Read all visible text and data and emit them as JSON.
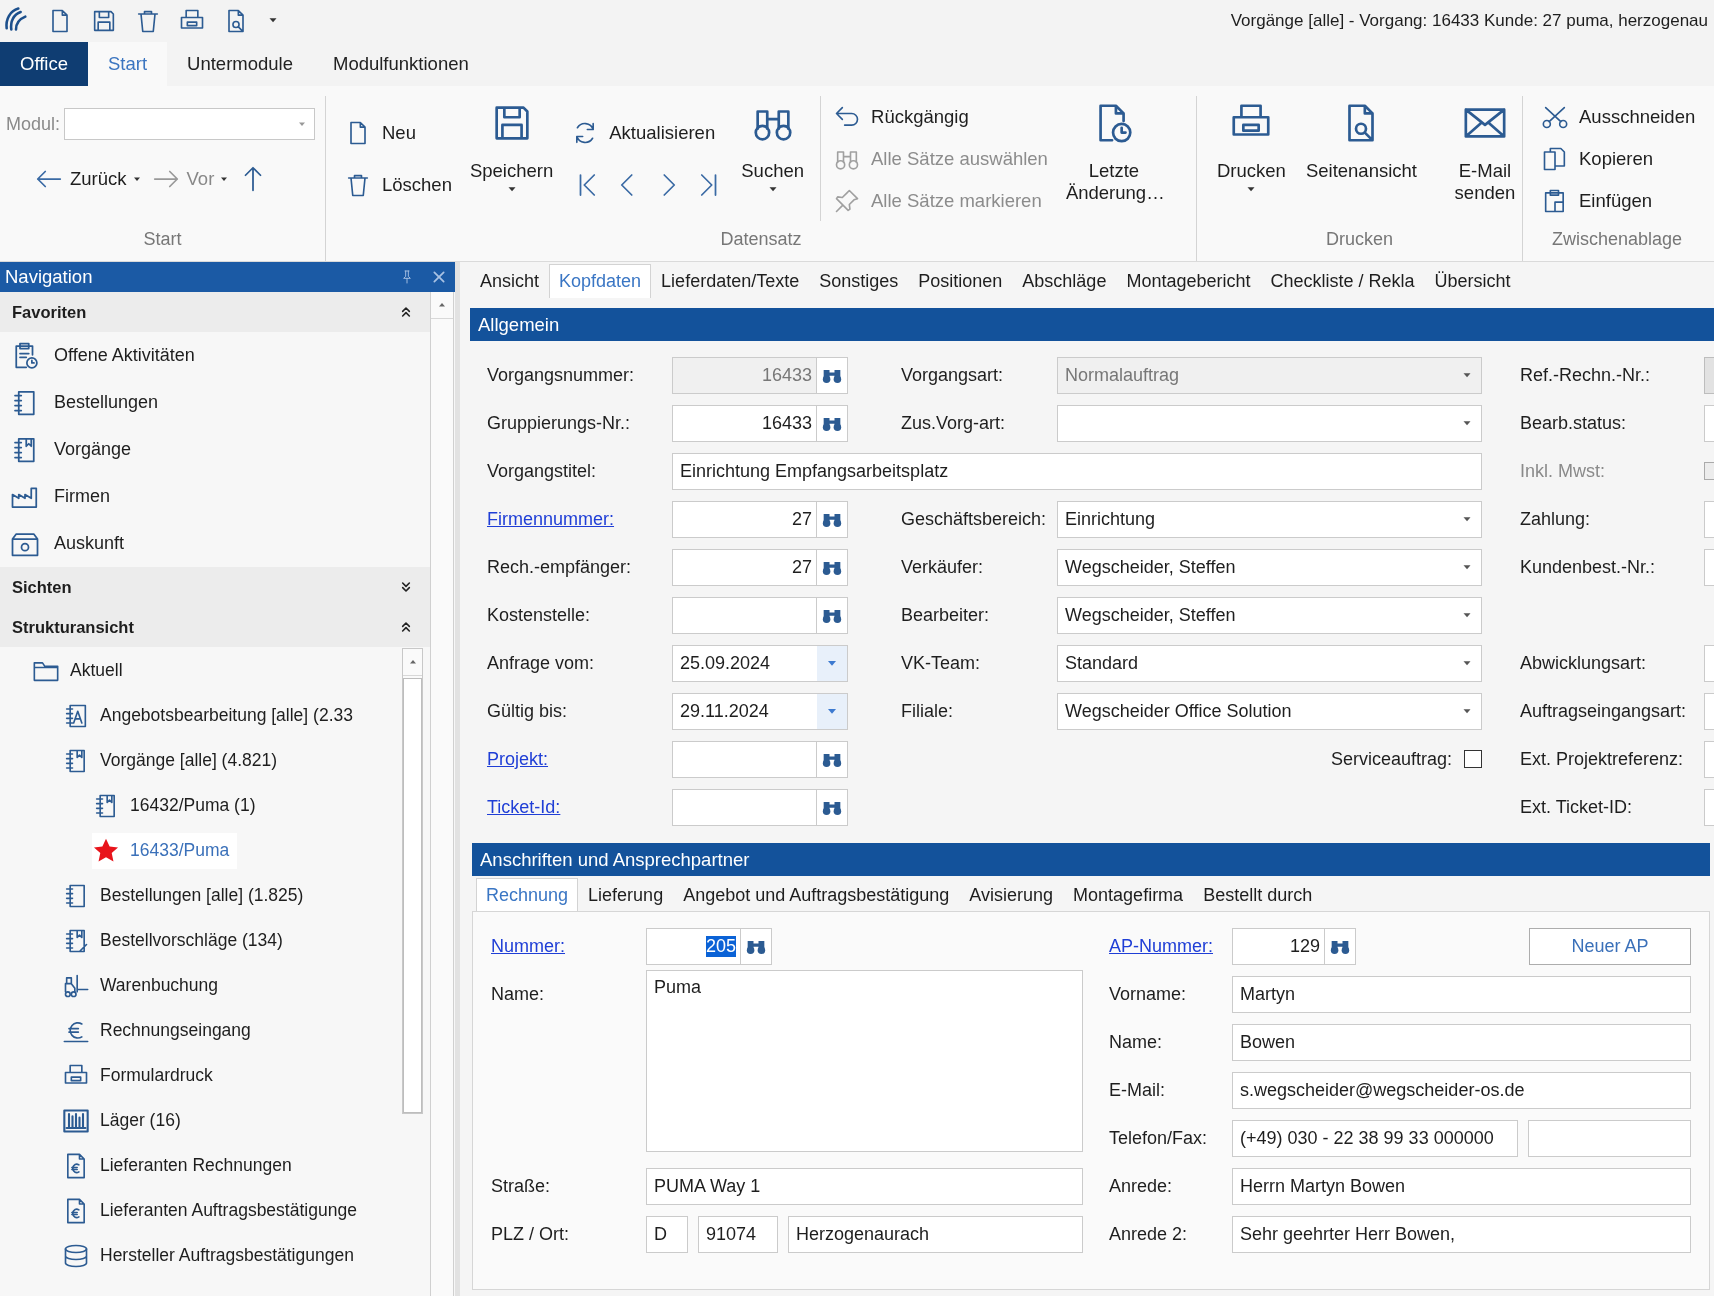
{
  "title_bar": {
    "title": "Vorgänge [alle] - Vorgang: 16433 Kunde: 27 puma, herzogenau"
  },
  "ribbon_tabs": [
    {
      "label": "Office",
      "kind": "app",
      "selected": false
    },
    {
      "label": "Start",
      "kind": "tab",
      "selected": true
    },
    {
      "label": "Untermodule",
      "kind": "tab",
      "selected": false
    },
    {
      "label": "Modulfunktionen",
      "kind": "tab",
      "selected": false
    }
  ],
  "ribbon": {
    "start": {
      "module_label": "Modul:",
      "back": {
        "label": "Zurück",
        "disabled": false
      },
      "forward": {
        "label": "Vor",
        "disabled": true
      },
      "label": "Start"
    },
    "record": {
      "new": "Neu",
      "delete": "Löschen",
      "save": {
        "label": "Speichern",
        "dropdown": true
      },
      "refresh": "Aktualisieren",
      "search": {
        "label": "Suchen",
        "dropdown": true
      },
      "undo": {
        "label": "Rückgängig",
        "disabled": false
      },
      "select_all": {
        "label": "Alle Sätze auswählen",
        "disabled": true
      },
      "mark_all": {
        "label": "Alle Sätze markieren",
        "disabled": true
      },
      "last_change": {
        "label": "Letzte Änderung…",
        "dropdown": false
      },
      "label": "Datensatz"
    },
    "print": {
      "print": {
        "label": "Drucken",
        "dropdown": true
      },
      "preview": {
        "label": "Seitenansicht",
        "dropdown": false
      },
      "email": {
        "label": "E-Mail senden",
        "dropdown": false
      },
      "label": "Drucken"
    },
    "clipboard": {
      "cut": "Ausschneiden",
      "copy": "Kopieren",
      "paste": "Einfügen",
      "label": "Zwischenablage"
    }
  },
  "navigation": {
    "title": "Navigation",
    "sections": [
      {
        "title": "Favoriten",
        "expanded": true,
        "items": [
          "Offene Aktivitäten",
          "Bestellungen",
          "Vorgänge",
          "Firmen",
          "Auskunft"
        ]
      },
      {
        "title": "Sichten",
        "expanded": false
      },
      {
        "title": "Strukturansicht",
        "expanded": true,
        "tree": [
          {
            "label": "Aktuell",
            "selected": false,
            "children": [
              {
                "label": "Angebotsbearbeitung [alle] (2.33",
                "selected": false
              },
              {
                "label": "Vorgänge [alle] (4.821)",
                "selected": false,
                "children": [
                  {
                    "label": "16432/Puma (1)",
                    "selected": false
                  },
                  {
                    "label": "16433/Puma",
                    "selected": true
                  }
                ]
              },
              {
                "label": "Bestellungen [alle] (1.825)",
                "selected": false
              },
              {
                "label": "Bestellvorschläge (134)",
                "selected": false
              },
              {
                "label": "Warenbuchung",
                "selected": false
              },
              {
                "label": "Rechnungseingang",
                "selected": false
              },
              {
                "label": "Formulardruck",
                "selected": false
              },
              {
                "label": "Läger (16)",
                "selected": false
              },
              {
                "label": "Lieferanten Rechnungen",
                "selected": false
              },
              {
                "label": "Lieferanten Auftragsbestätigunge",
                "selected": false
              },
              {
                "label": "Hersteller Auftragsbestätigungen",
                "selected": false
              }
            ]
          }
        ]
      }
    ]
  },
  "tabs": [
    {
      "label": "Ansicht",
      "selected": false
    },
    {
      "label": "Kopfdaten",
      "selected": true
    },
    {
      "label": "Lieferdaten/Texte",
      "selected": false
    },
    {
      "label": "Sonstiges",
      "selected": false
    },
    {
      "label": "Positionen",
      "selected": false
    },
    {
      "label": "Abschläge",
      "selected": false
    },
    {
      "label": "Montagebericht",
      "selected": false
    },
    {
      "label": "Checkliste / Rekla",
      "selected": false
    },
    {
      "label": "Übersicht",
      "selected": false
    }
  ],
  "general": {
    "title": "Allgemein",
    "rows": [
      {
        "left": {
          "label": "Vorgangsnummer:",
          "link": false,
          "kind": "lookup",
          "value": "16433",
          "disabled": true
        },
        "middle": {
          "label": "Vorgangsart:",
          "kind": "combo",
          "value": "Normalauftrag",
          "disabled": true
        },
        "right": {
          "label": "Ref.-Rechn.-Nr.:",
          "kind": "stub",
          "disabled": true
        }
      },
      {
        "left": {
          "label": "Gruppierungs-Nr.:",
          "link": false,
          "kind": "lookup",
          "value": "16433",
          "disabled": false
        },
        "middle": {
          "label": "Zus.Vorg-art:",
          "kind": "combo",
          "disabled": false
        },
        "right": {
          "label": "Bearb.status:",
          "kind": "stub",
          "disabled": false
        }
      },
      {
        "left": {
          "label": "Vorgangstitel:",
          "link": false,
          "kind": "wide",
          "value": "Einrichtung Empfangsarbeitsplatz"
        },
        "right": {
          "label": "Inkl. Mwst:",
          "kind": "check",
          "checked": false,
          "disabled": true
        }
      },
      {
        "left": {
          "label": "Firmennummer:",
          "link": true,
          "kind": "lookup",
          "value": "27",
          "disabled": false
        },
        "middle": {
          "label": "Geschäftsbereich:",
          "kind": "combo",
          "value": "Einrichtung",
          "disabled": false
        },
        "right": {
          "label": "Zahlung:",
          "kind": "stub",
          "disabled": false
        }
      },
      {
        "left": {
          "label": "Rech.-empfänger:",
          "link": false,
          "kind": "lookup",
          "value": "27",
          "disabled": false
        },
        "middle": {
          "label": "Verkäufer:",
          "kind": "combo",
          "value": "Wegscheider, Steffen",
          "disabled": false
        },
        "right": {
          "label": "Kundenbest.-Nr.:",
          "kind": "stub",
          "disabled": false
        }
      },
      {
        "left": {
          "label": "Kostenstelle:",
          "link": false,
          "kind": "lookup",
          "disabled": false
        },
        "middle": {
          "label": "Bearbeiter:",
          "kind": "combo",
          "value": "Wegscheider, Steffen",
          "disabled": false
        }
      },
      {
        "left": {
          "label": "Anfrage vom:",
          "link": false,
          "kind": "date",
          "value": "25.09.2024"
        },
        "middle": {
          "label": "VK-Team:",
          "kind": "combo",
          "value": "Standard",
          "disabled": false
        },
        "right": {
          "label": "Abwicklungsart:",
          "kind": "stub",
          "disabled": false
        }
      },
      {
        "left": {
          "label": "Gültig bis:",
          "link": false,
          "kind": "date",
          "value": "29.11.2024"
        },
        "middle": {
          "label": "Filiale:",
          "kind": "combo",
          "value": "Wegscheider Office Solution",
          "disabled": false
        },
        "right": {
          "label": "Auftragseingangsart:",
          "kind": "stub",
          "disabled": false
        }
      },
      {
        "left": {
          "label": "Projekt:",
          "link": true,
          "kind": "lookup",
          "disabled": false
        },
        "middle": {
          "label": "Serviceauftrag:",
          "kind": "check",
          "checked": false,
          "disabled": false
        },
        "right": {
          "label": "Ext. Projektreferenz:",
          "kind": "stub",
          "disabled": false
        }
      },
      {
        "left": {
          "label": "Ticket-Id:",
          "link": true,
          "kind": "lookup",
          "disabled": false
        },
        "right": {
          "label": "Ext. Ticket-ID:",
          "kind": "stub",
          "disabled": false
        }
      }
    ]
  },
  "address": {
    "title": "Anschriften und Ansprechpartner",
    "tabs": [
      {
        "label": "Rechnung",
        "selected": true
      },
      {
        "label": "Lieferung",
        "selected": false
      },
      {
        "label": "Angebot und Auftragsbestätigung",
        "selected": false
      },
      {
        "label": "Avisierung",
        "selected": false
      },
      {
        "label": "Montagefirma",
        "selected": false
      },
      {
        "label": "Bestellt durch",
        "selected": false
      }
    ],
    "left": [
      {
        "label": "Nummer:",
        "link": true,
        "kind": "lookup",
        "value": "205",
        "value_selected": true
      },
      {
        "label": "Name:",
        "link": false,
        "kind": "memo",
        "value": "Puma"
      },
      {
        "label": "Straße:",
        "link": false,
        "kind": "text",
        "value": "PUMA Way 1"
      },
      {
        "label": "PLZ / Ort:",
        "link": false,
        "kind": "multi",
        "values": [
          "D",
          "91074",
          "Herzogenaurach"
        ]
      }
    ],
    "right": [
      {
        "label": "AP-Nummer:",
        "link": true,
        "kind": "lookup",
        "value": "129",
        "button": "Neuer AP"
      },
      {
        "label": "Vorname:",
        "link": false,
        "kind": "text",
        "value": "Martyn"
      },
      {
        "label": "Name:",
        "link": false,
        "kind": "text",
        "value": "Bowen"
      },
      {
        "label": "E-Mail:",
        "link": false,
        "kind": "text",
        "value": "s.wegscheider@wegscheider-os.de"
      },
      {
        "label": "Telefon/Fax:",
        "link": false,
        "kind": "pair",
        "value": "(+49) 030 - 22 38 99 33 000000"
      },
      {
        "label": "Anrede:",
        "link": false,
        "kind": "text",
        "value": "Herrn Martyn Bowen"
      },
      {
        "label": "Anrede 2:",
        "link": false,
        "kind": "text",
        "value": "Sehr geehrter Herr Bowen,"
      }
    ]
  }
}
